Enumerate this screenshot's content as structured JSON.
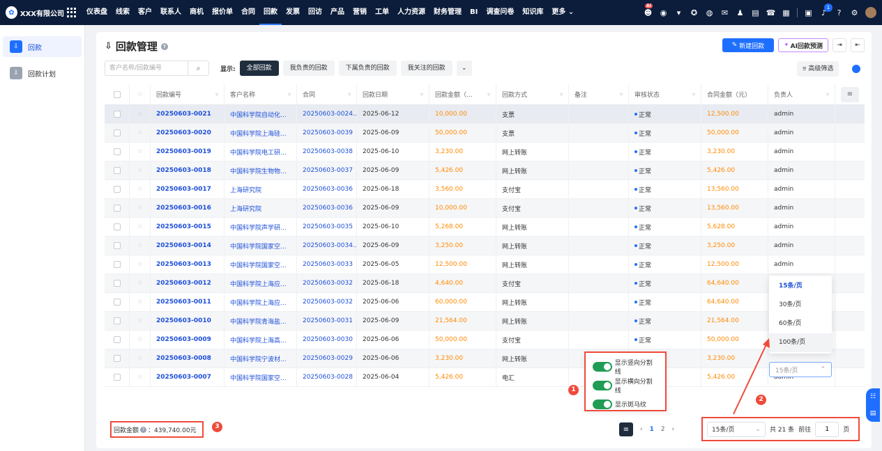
{
  "nav": {
    "company": "XXX有限公司",
    "items": [
      "仪表盘",
      "线索",
      "客户",
      "联系人",
      "商机",
      "报价单",
      "合同",
      "回款",
      "发票",
      "回访",
      "产品",
      "营销",
      "工单",
      "人力资源",
      "财务管理",
      "BI",
      "调查问卷",
      "知识库",
      "更多"
    ],
    "active": "回款",
    "ai_badge": "AI",
    "notif_count": "1"
  },
  "sidebar": {
    "items": [
      {
        "label": "回款",
        "active": true
      },
      {
        "label": "回款计划",
        "active": false
      }
    ]
  },
  "header": {
    "title": "回款管理",
    "new_button": "新建回款",
    "ai_button": "AI回款预测"
  },
  "filter": {
    "search_placeholder": "客户名称/回款编号",
    "show_label": "显示:",
    "segments": [
      "全部回款",
      "我负责的回款",
      "下属负责的回款",
      "我关注的回款"
    ],
    "advanced": "高级筛选"
  },
  "table": {
    "columns": [
      "回款编号",
      "客户名称",
      "合同",
      "回款日期",
      "回款金额（...",
      "回款方式",
      "备注",
      "审核状态",
      "合同金额（元）",
      "负责人"
    ],
    "rows": [
      [
        "20250603-0021",
        "中国科学院自动化...",
        "20250603-0024...",
        "2025-06-12",
        "10,000.00",
        "支票",
        "",
        "正常",
        "12,500.00",
        "admin"
      ],
      [
        "20250603-0020",
        "中国科学院上海硅...",
        "20250603-0039",
        "2025-06-09",
        "50,000.00",
        "支票",
        "",
        "正常",
        "50,000.00",
        "admin"
      ],
      [
        "20250603-0019",
        "中国科学院电工研...",
        "20250603-0038",
        "2025-06-10",
        "3,230.00",
        "网上转账",
        "",
        "正常",
        "3,230.00",
        "admin"
      ],
      [
        "20250603-0018",
        "中国科学院生物物...",
        "20250603-0037",
        "2025-06-09",
        "5,426.00",
        "网上转账",
        "",
        "正常",
        "5,426.00",
        "admin"
      ],
      [
        "20250603-0017",
        "上海研究院",
        "20250603-0036",
        "2025-06-18",
        "3,560.00",
        "支付宝",
        "",
        "正常",
        "13,560.00",
        "admin"
      ],
      [
        "20250603-0016",
        "上海研究院",
        "20250603-0036",
        "2025-06-09",
        "10,000.00",
        "支付宝",
        "",
        "正常",
        "13,560.00",
        "admin"
      ],
      [
        "20250603-0015",
        "中国科学院声学研...",
        "20250603-0035",
        "2025-06-10",
        "5,268.00",
        "网上转账",
        "",
        "正常",
        "5,628.00",
        "admin"
      ],
      [
        "20250603-0014",
        "中国科学院国家空...",
        "20250603-0034...",
        "2025-06-09",
        "3,250.00",
        "网上转账",
        "",
        "正常",
        "3,250.00",
        "admin"
      ],
      [
        "20250603-0013",
        "中国科学院国家空...",
        "20250603-0033",
        "2025-06-05",
        "12,500.00",
        "网上转账",
        "",
        "正常",
        "12,500.00",
        "admin"
      ],
      [
        "20250603-0012",
        "中国科学院上海应...",
        "20250603-0032",
        "2025-06-18",
        "4,640.00",
        "支付宝",
        "",
        "正常",
        "64,640.00",
        "admin"
      ],
      [
        "20250603-0011",
        "中国科学院上海应...",
        "20250603-0032",
        "2025-06-06",
        "60,000.00",
        "网上转账",
        "",
        "正常",
        "64,640.00",
        "admin"
      ],
      [
        "20250603-0010",
        "中国科学院青海盐...",
        "20250603-0031",
        "2025-06-09",
        "21,564.00",
        "网上转账",
        "",
        "正常",
        "21,564.00",
        "admin"
      ],
      [
        "20250603-0009",
        "中国科学院上海高...",
        "20250603-0030",
        "2025-06-06",
        "50,000.00",
        "支付宝",
        "",
        "正常",
        "50,000.00",
        "admin"
      ],
      [
        "20250603-0008",
        "中国科学院宁波材...",
        "20250603-0029",
        "2025-06-06",
        "3,230.00",
        "网上转账",
        "",
        "",
        "3,230.00",
        ""
      ],
      [
        "20250603-0007",
        "中国科学院国家空...",
        "20250603-0028",
        "2025-06-04",
        "5,426.00",
        "电汇",
        "",
        "",
        "5,426.00",
        "admin"
      ]
    ]
  },
  "footer": {
    "total_label": "回款金额",
    "total_value": "：439,740.00元",
    "pages": [
      "1",
      "2"
    ],
    "page_size": "15条/页",
    "total_count": "共 21 条",
    "goto_label": "前往",
    "goto_value": "1",
    "page_unit": "页"
  },
  "switches": [
    "显示竖向分割线",
    "显示横向分割线",
    "显示斑马纹"
  ],
  "size_options": [
    "15条/页",
    "30条/页",
    "60条/页",
    "100条/页"
  ],
  "inline_select": "15条/页",
  "annotations": [
    "1",
    "2",
    "3"
  ],
  "colors": {
    "accent": "#1e6fff",
    "amount": "#ff8a00",
    "highlight": "#f04a3a",
    "nav_bg": "#0b1d3a"
  }
}
